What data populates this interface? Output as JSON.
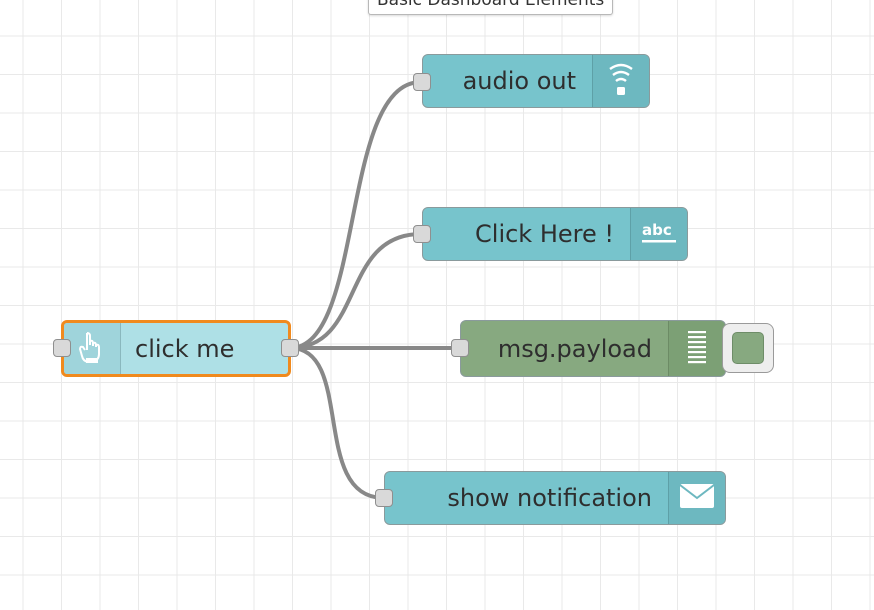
{
  "flow_tab": {
    "label": "Basic Dashboard Elements"
  },
  "nodes": {
    "inject": {
      "label": "click me",
      "icon": "hand-pointer-icon",
      "selected": true,
      "color": "#aee0e6",
      "border": "#f08a1e"
    },
    "audio": {
      "label": "audio out",
      "icon": "audio-signal-icon",
      "color": "#77c4cc"
    },
    "text": {
      "label": "Click Here !",
      "icon": "abc-text-icon",
      "color": "#77c4cc"
    },
    "debug": {
      "label": "msg.payload",
      "icon": "debug-list-icon",
      "color": "#87a980",
      "enabled": true
    },
    "notify": {
      "label": "show notification",
      "icon": "envelope-icon",
      "color": "#77c4cc"
    }
  },
  "colors": {
    "wire": "#888888",
    "grid": "#e9e9e9",
    "selection": "#f08a1e"
  }
}
